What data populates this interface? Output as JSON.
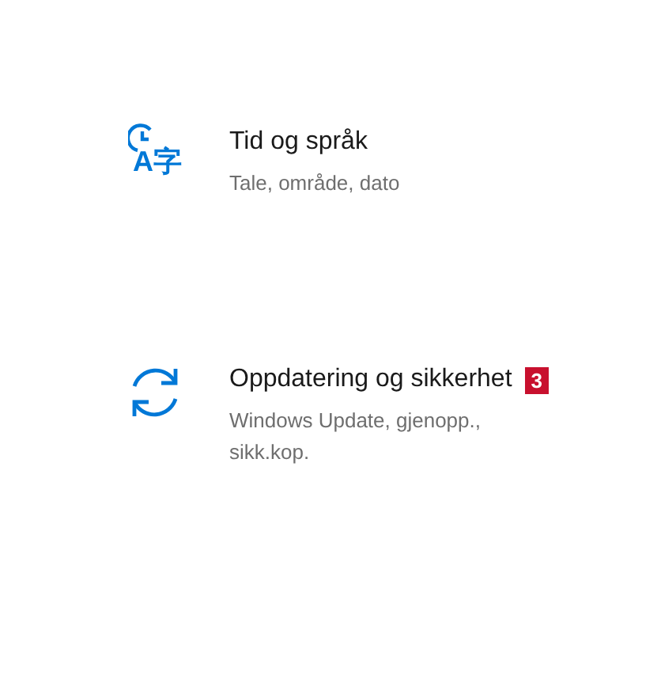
{
  "tiles": [
    {
      "kind": "time-language",
      "icon_text": "A字",
      "title": "Tid og språk",
      "subtitle": "Tale, område, dato"
    },
    {
      "kind": "update",
      "title": "Oppdatering og sikkerhet",
      "badge": "3",
      "subtitle": "Windows Update, gjenopp., sikk.kop."
    }
  ]
}
